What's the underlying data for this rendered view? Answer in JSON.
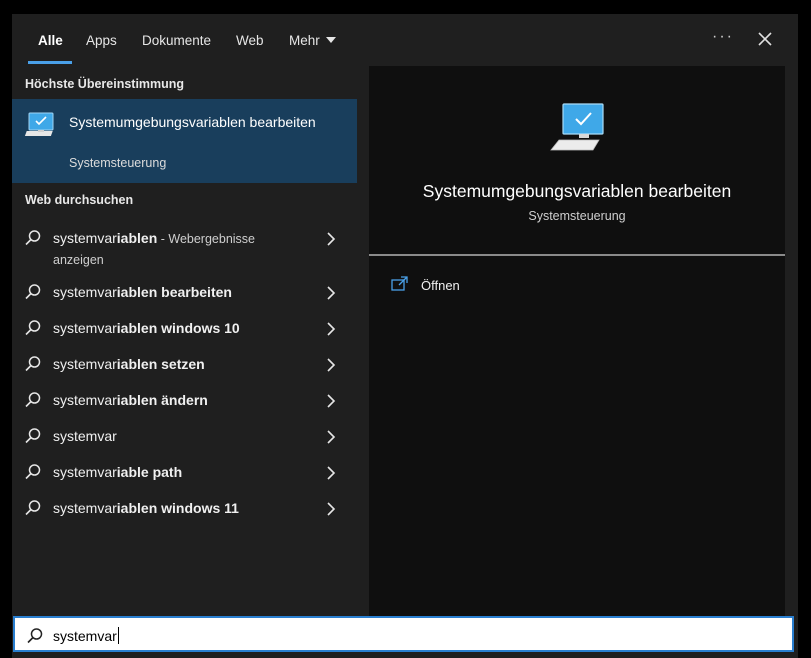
{
  "tabs": [
    {
      "label": "Alle"
    },
    {
      "label": "Apps"
    },
    {
      "label": "Dokumente"
    },
    {
      "label": "Web"
    },
    {
      "label": "Mehr"
    }
  ],
  "left": {
    "best_match_header": "Höchste Übereinstimmung",
    "best_match": {
      "title": "Systemumgebungsvariablen bearbeiten",
      "subtitle": "Systemsteuerung"
    },
    "web_header": "Web durchsuchen",
    "results": [
      {
        "prefix": "systemvar",
        "bold": "iablen",
        "hint": " - Webergebnisse",
        "hint2": "anzeigen"
      },
      {
        "prefix": "systemvar",
        "bold": "iablen bearbeiten"
      },
      {
        "prefix": "systemvar",
        "bold": "iablen windows 10"
      },
      {
        "prefix": "systemvar",
        "bold": "iablen setzen"
      },
      {
        "prefix": "systemvar",
        "bold": "iablen ändern"
      },
      {
        "prefix": "systemvar",
        "bold": ""
      },
      {
        "prefix": "systemvar",
        "bold": "iable path"
      },
      {
        "prefix": "systemvar",
        "bold": "iablen windows 11"
      }
    ]
  },
  "right": {
    "title": "Systemumgebungsvariablen bearbeiten",
    "subtitle": "Systemsteuerung",
    "action_label": "Öffnen"
  },
  "search": {
    "value": "systemvar"
  },
  "colors": {
    "accent": "#4aa0e8",
    "selected_bg": "#193e5c",
    "panel_bg": "#1f1f1f",
    "preview_bg": "#0f0f0f"
  }
}
